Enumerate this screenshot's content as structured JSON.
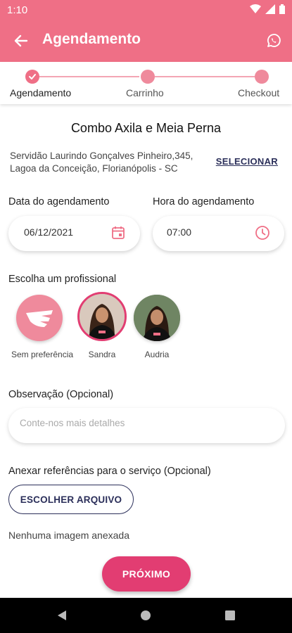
{
  "status_bar": {
    "time": "1:10"
  },
  "app_bar": {
    "title": "Agendamento"
  },
  "stepper": {
    "steps": [
      {
        "label": "Agendamento",
        "state": "done"
      },
      {
        "label": "Carrinho",
        "state": "pending"
      },
      {
        "label": "Checkout",
        "state": "pending"
      }
    ]
  },
  "service": {
    "title": "Combo Axila e Meia Perna",
    "address_line1": "Servidão Laurindo Gonçalves Pinheiro,345,",
    "address_line2": "Lagoa da Conceição, Florianópolis - SC",
    "select_label": "SELECIONAR"
  },
  "date": {
    "label": "Data do agendamento",
    "value": "06/12/2021",
    "icon": "calendar-icon"
  },
  "time": {
    "label": "Hora do agendamento",
    "value": "07:00",
    "icon": "clock-icon"
  },
  "professionals": {
    "label": "Escolha um profissional",
    "items": [
      {
        "name": "Sem preferência",
        "selected": false,
        "icon": "wing-icon"
      },
      {
        "name": "Sandra",
        "selected": true,
        "icon": "avatar"
      },
      {
        "name": "Audria",
        "selected": false,
        "icon": "avatar"
      }
    ]
  },
  "observation": {
    "label": "Observação (Opcional)",
    "placeholder": "Conte-nos mais detalhes",
    "value": ""
  },
  "attachments": {
    "label": "Anexar referências para o serviço (Opcional)",
    "button_label": "ESCOLHER ARQUIVO",
    "empty_text": "Nenhuma imagem anexada"
  },
  "next_button": {
    "label": "PRÓXIMO"
  },
  "colors": {
    "primary": "#ef6f86",
    "accent": "#e23d72",
    "navy": "#2b2f5a"
  }
}
